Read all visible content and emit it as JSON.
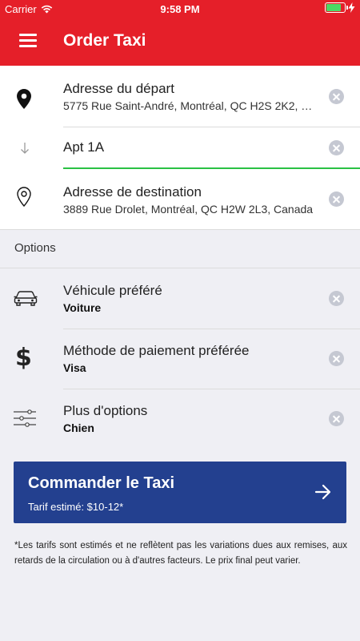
{
  "status_bar": {
    "carrier": "Carrier",
    "time": "9:58 PM"
  },
  "header": {
    "title": "Order Taxi",
    "menu_icon": "hamburger-menu-icon"
  },
  "addresses": {
    "departure": {
      "label": "Adresse du départ",
      "value": "5775 Rue Saint-André, Montréal, QC H2S 2K2, Canada",
      "icon": "map-pin-filled-icon"
    },
    "apartment": {
      "value": "Apt 1A",
      "icon": "arrow-down-icon"
    },
    "destination": {
      "label": "Adresse de destination",
      "value": "3889 Rue Drolet, Montréal, QC H2W 2L3, Canada",
      "icon": "map-pin-outline-icon"
    }
  },
  "options": {
    "header": "Options",
    "items": [
      {
        "label": "Véhicule préféré",
        "value": "Voiture",
        "icon": "car-icon"
      },
      {
        "label": "Méthode de paiement préférée",
        "value": "Visa",
        "icon": "dollar-icon"
      },
      {
        "label": "Plus d'options",
        "value": "Chien",
        "icon": "sliders-icon"
      }
    ]
  },
  "order_button": {
    "title": "Commander le Taxi",
    "subtitle": "Tarif estimé: $10-12*",
    "icon": "arrow-right-icon"
  },
  "disclaimer": "*Les tarifs sont estimés et ne reflètent pas les variations dues aux remises, aux retards de la circulation ou à d'autres facteurs. Le prix final peut varier.",
  "colors": {
    "brand_red": "#e51f29",
    "button_blue": "#23408f",
    "active_green": "#2ac144",
    "clear_grey": "#c5c8d2"
  }
}
